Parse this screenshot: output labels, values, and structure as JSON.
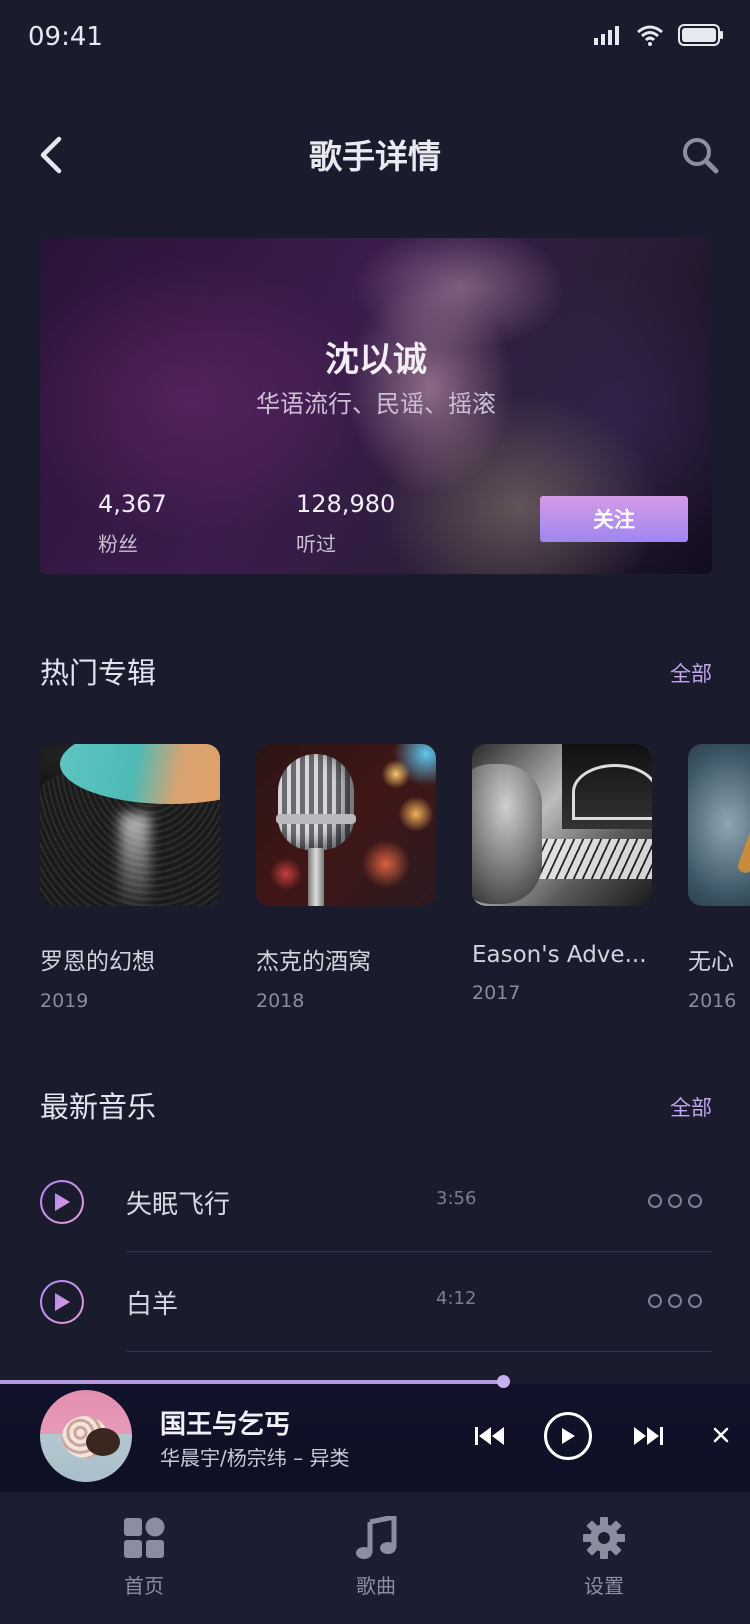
{
  "status_bar": {
    "time": "09:41"
  },
  "header": {
    "title": "歌手详情"
  },
  "artist": {
    "name": "沈以诚",
    "genres": "华语流行、民谣、摇滚",
    "stats": [
      {
        "value": "4,367",
        "label": "粉丝"
      },
      {
        "value": "128,980",
        "label": "听过"
      }
    ],
    "follow_label": "关注"
  },
  "albums_section": {
    "title": "热门专辑",
    "more_label": "全部",
    "items": [
      {
        "name": "罗恩的幻想",
        "year": "2019"
      },
      {
        "name": "杰克的酒窝",
        "year": "2018"
      },
      {
        "name": "Eason's Adve...",
        "year": "2017"
      },
      {
        "name": "无心",
        "year": "2016"
      }
    ]
  },
  "songs_section": {
    "title": "最新音乐",
    "more_label": "全部",
    "items": [
      {
        "title": "失眠飞行",
        "duration": "3:56"
      },
      {
        "title": "白羊",
        "duration": "4:12"
      }
    ]
  },
  "player": {
    "title": "国王与乞丐",
    "artist": "华晨宇/杨宗纬 – 异类",
    "progress_percent": 67
  },
  "tabs": [
    {
      "label": "首页",
      "icon": "grid-icon"
    },
    {
      "label": "歌曲",
      "icon": "music-note-icon"
    },
    {
      "label": "设置",
      "icon": "gear-icon"
    }
  ],
  "colors": {
    "background": "#1a1c2e",
    "accent": "#b799e3",
    "follow_gradient_start": "#d59ae8",
    "follow_gradient_end": "#9f86f0"
  }
}
